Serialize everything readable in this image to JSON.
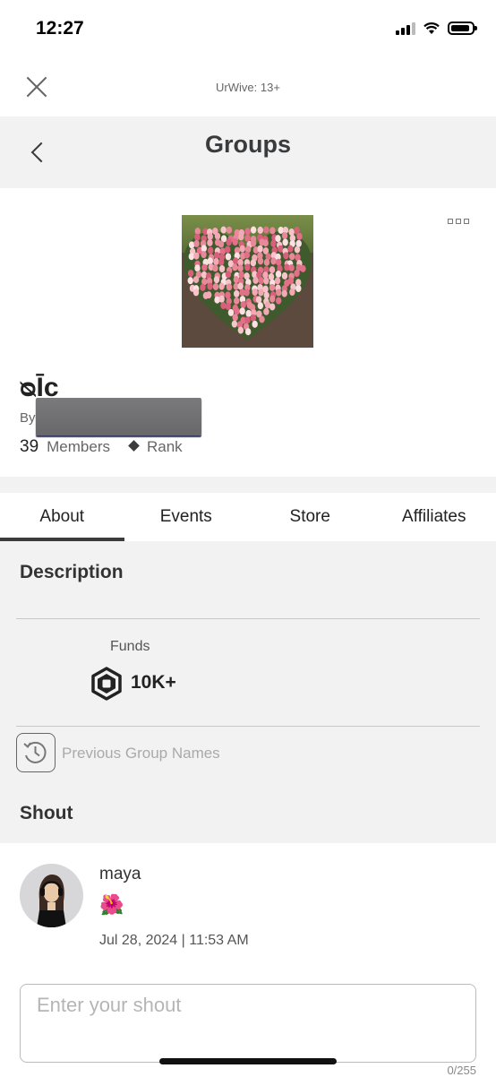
{
  "status_bar": {
    "time": "12:27"
  },
  "top_bar": {
    "site_label": "UrWive: 13+"
  },
  "header": {
    "title": "Groups"
  },
  "group": {
    "name": "ᴓĪᴄ",
    "by_label": "By",
    "members_count": "39",
    "members_label": "Members",
    "rank_label": "Rank"
  },
  "tabs": [
    {
      "label": "About",
      "active": true
    },
    {
      "label": "Events",
      "active": false
    },
    {
      "label": "Store",
      "active": false
    },
    {
      "label": "Affiliates",
      "active": false
    }
  ],
  "about": {
    "description_title": "Description",
    "funds_label": "Funds",
    "funds_value": "10K+",
    "previous_names_label": "Previous Group Names",
    "shout_title": "Shout"
  },
  "shout": {
    "username": "maya",
    "message": "🌺",
    "date": "Jul 28, 2024 | 11:53 AM"
  },
  "shout_input": {
    "placeholder": "Enter your shout",
    "char_count": "0/255"
  },
  "colors": {
    "text_primary": "#393b3d",
    "section_bg": "#f2f2f3",
    "accent_bar": "#393b3d"
  }
}
